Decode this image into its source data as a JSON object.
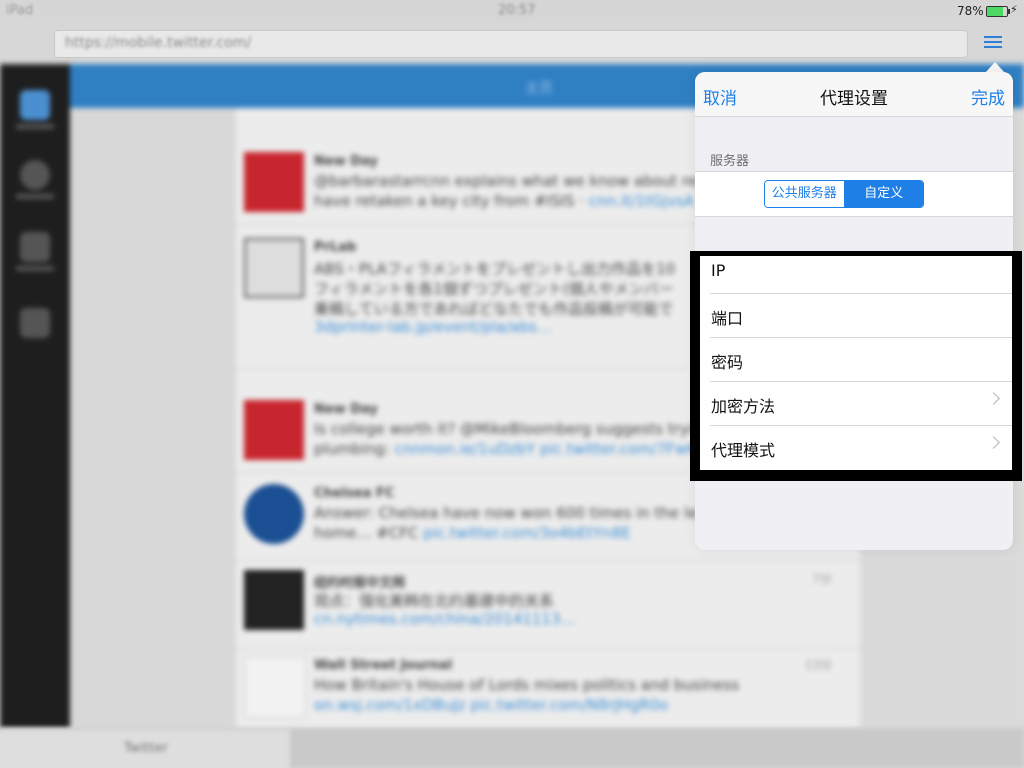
{
  "status_bar": {
    "carrier": "iPad",
    "time": "20:57",
    "battery": "78%"
  },
  "browser": {
    "url": "https://mobile.twitter.com/",
    "tab_title": "Twitter"
  },
  "background_app": {
    "header_title": "主页",
    "tweets": [
      {
        "name": "New Day",
        "line1": "@barbarastarrcnn explains what we know about repo",
        "line2": "have retaken a key city from #ISIS",
        "link": "cnn.it/1tGjvsA"
      },
      {
        "name": "PrLab",
        "line1": "ABS・PLAフィラメントをプレゼントし出力作品を10",
        "line2": "フィラメントを各1個ずつプレゼント(個人やメンバー",
        "line3": "乗稿している方であればどなたでも作品投稿が可能で",
        "link": "3dprinter-lab.jp/event/pla/abs…"
      },
      {
        "name": "New Day",
        "line1": "Is college worth it? @MikeBloomberg suggests trying",
        "line2": "plumbing:",
        "link": "cnnmon.ie/1uDzbY pic.twitter.com/7FwKJ"
      },
      {
        "name": "Chelsea FC",
        "line1": "Answer: Chelsea have now won 600 times in the leag",
        "line2": "home… #CFC",
        "link": "pic.twitter.com/3o4bEtYn8E"
      },
      {
        "name": "纽约时报中文网",
        "line1": "观点：强化美韩在北约基建中的关系",
        "link": "cn.nytimes.com/china/20141113…",
        "time": "7分"
      },
      {
        "name": "Wall Street Journal",
        "line1": "How Britain's House of Lords mixes politics and business",
        "link": "on.wsj.com/1xDBuJz pic.twitter.com/N8rJHgR0o",
        "time": "13分"
      }
    ]
  },
  "popover": {
    "cancel_label": "取消",
    "title": "代理设置",
    "done_label": "完成",
    "server_section_label": "服务器",
    "segments": [
      {
        "label": "公共服务器",
        "selected": false
      },
      {
        "label": "自定义",
        "selected": true
      }
    ],
    "rows": [
      {
        "label": "IP",
        "has_chevron": false
      },
      {
        "label": "端口",
        "has_chevron": false
      },
      {
        "label": "密码",
        "has_chevron": false
      },
      {
        "label": "加密方法",
        "has_chevron": true
      },
      {
        "label": "代理模式",
        "has_chevron": true
      }
    ],
    "accent_color": "#1E7FE6"
  }
}
